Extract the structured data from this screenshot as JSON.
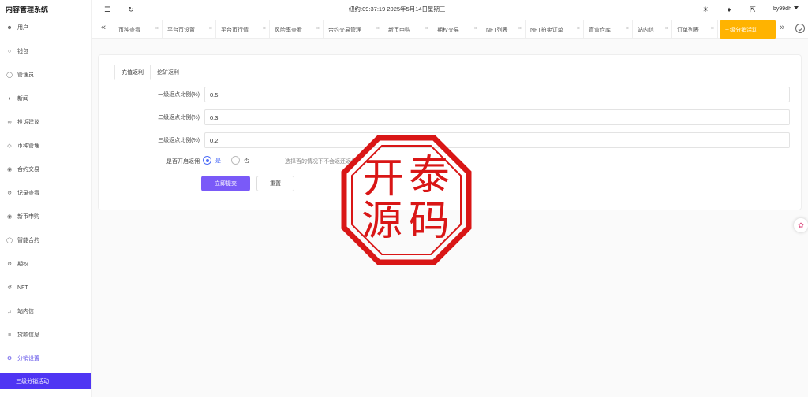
{
  "app": {
    "title": "内容管理系统"
  },
  "sidebar": {
    "items": [
      {
        "label": "用户",
        "icon": "user-icon"
      },
      {
        "label": "钱包",
        "icon": "wallet-icon"
      },
      {
        "label": "管理员",
        "icon": "admin-icon"
      },
      {
        "label": "新闻",
        "icon": "news-icon"
      },
      {
        "label": "投诉建议",
        "icon": "feedback-icon"
      },
      {
        "label": "币种管理",
        "icon": "coin-icon"
      },
      {
        "label": "合约交易",
        "icon": "contract-icon"
      },
      {
        "label": "记录查看",
        "icon": "record-icon"
      },
      {
        "label": "新币申购",
        "icon": "subscribe-icon"
      },
      {
        "label": "智能合约",
        "icon": "smart-contract-icon"
      },
      {
        "label": "期权",
        "icon": "option-icon"
      },
      {
        "label": "NFT",
        "icon": "nft-icon"
      },
      {
        "label": "站内信",
        "icon": "bell-icon"
      },
      {
        "label": "贷款信息",
        "icon": "loan-icon"
      },
      {
        "label": "分销设置",
        "icon": "gear-icon"
      }
    ],
    "active_sub": "三级分销活动"
  },
  "header": {
    "clock": "纽约:09:37:19 2025年5月14日星期三",
    "user": "by99dh"
  },
  "tabs": [
    "币种查看",
    "平台币设置",
    "平台币行情",
    "风险率查看",
    "合约交易管理",
    "新币申购",
    "期权交易",
    "NFT列表",
    "NFT拍卖订单",
    "盲盒仓库",
    "站内信",
    "订单列表",
    "三级分销活动"
  ],
  "form": {
    "subtabs": [
      "充值返利",
      "挖矿返利"
    ],
    "fields": [
      {
        "label": "一级返点比例(%)",
        "value": "0.5"
      },
      {
        "label": "二级返点比例(%)",
        "value": "0.3"
      },
      {
        "label": "三级返点比例(%)",
        "value": "0.2"
      }
    ],
    "switch_label": "是否开启返佣",
    "yes_label": "是",
    "no_label": "否",
    "hint": "选择否的情况下不会返还返佣",
    "submit_label": "立即提交",
    "reset_label": "重置"
  },
  "stamp": {
    "chars": [
      "开",
      "泰",
      "源",
      "码"
    ],
    "color": "#d91616"
  },
  "colors": {
    "primary": "#7a5af8",
    "active_tab": "#ffb300",
    "sidebar_active": "#4f35f3"
  }
}
